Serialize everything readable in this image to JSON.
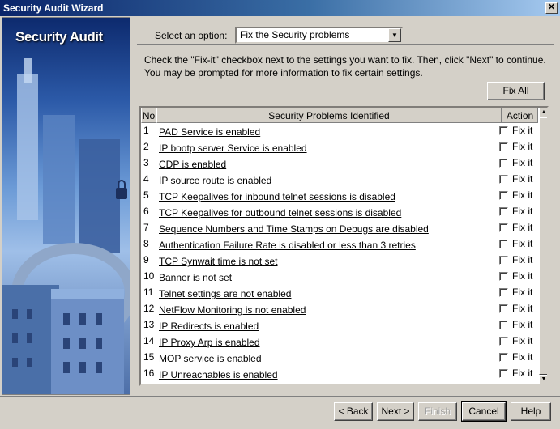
{
  "window": {
    "title": "Security Audit Wizard",
    "close_glyph": "✕"
  },
  "sidebar": {
    "title": "Security Audit"
  },
  "option": {
    "label": "Select an option:",
    "selected": "Fix the Security problems"
  },
  "instructions": {
    "line1": "Check the \"Fix-it\" checkbox next to the settings you want to fix. Then, click \"Next\" to continue.",
    "line2": "You may be prompted for more information to fix certain settings."
  },
  "fix_all_label": "Fix All",
  "table": {
    "col_no": "No",
    "col_problem": "Security Problems Identified",
    "col_action": "Action",
    "fix_label": "Fix it",
    "rows": [
      {
        "no": "1",
        "problem": "PAD Service is enabled"
      },
      {
        "no": "2",
        "problem": "IP bootp server Service is enabled"
      },
      {
        "no": "3",
        "problem": "CDP is enabled"
      },
      {
        "no": "4",
        "problem": "IP source route is enabled"
      },
      {
        "no": "5",
        "problem": "TCP Keepalives for inbound telnet sessions is disabled"
      },
      {
        "no": "6",
        "problem": "TCP Keepalives for outbound telnet sessions is disabled"
      },
      {
        "no": "7",
        "problem": "Sequence Numbers and Time Stamps on Debugs are disabled"
      },
      {
        "no": "8",
        "problem": "Authentication Failure Rate is disabled or less than 3 retries"
      },
      {
        "no": "9",
        "problem": "TCP Synwait time is not set"
      },
      {
        "no": "10",
        "problem": "Banner is not set"
      },
      {
        "no": "11",
        "problem": "Telnet settings are not enabled"
      },
      {
        "no": "12",
        "problem": "NetFlow Monitoring is not enabled"
      },
      {
        "no": "13",
        "problem": "IP Redirects is enabled"
      },
      {
        "no": "14",
        "problem": "IP Proxy Arp is enabled"
      },
      {
        "no": "15",
        "problem": "MOP service is enabled"
      },
      {
        "no": "16",
        "problem": "IP Unreachables is enabled"
      }
    ]
  },
  "footer": {
    "back": "< Back",
    "next": "Next >",
    "finish": "Finish",
    "cancel": "Cancel",
    "help": "Help"
  }
}
